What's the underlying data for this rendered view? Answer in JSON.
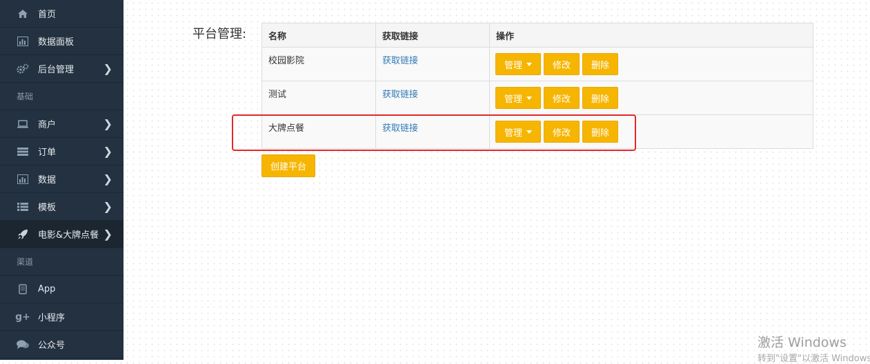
{
  "sidebar": {
    "items": [
      {
        "label": "首页",
        "icon": "home-icon"
      },
      {
        "label": "数据面板",
        "icon": "bar-chart-icon"
      },
      {
        "label": "后台管理",
        "icon": "gears-icon",
        "has_children": true
      }
    ],
    "section_basic": "基础",
    "basic_items": [
      {
        "label": "商户",
        "icon": "laptop-icon",
        "has_children": true
      },
      {
        "label": "订单",
        "icon": "list-box-icon",
        "has_children": true
      },
      {
        "label": "数据",
        "icon": "bar-chart-icon",
        "has_children": true
      },
      {
        "label": "模板",
        "icon": "list-icon",
        "has_children": true
      },
      {
        "label": "电影&大牌点餐",
        "icon": "rocket-icon",
        "has_children": true,
        "active": true
      }
    ],
    "section_channel": "渠道",
    "channel_items": [
      {
        "label": "App",
        "icon": "tablet-icon"
      },
      {
        "label": "小程序",
        "icon": "google-plus-icon"
      },
      {
        "label": "公众号",
        "icon": "chat-icon"
      }
    ]
  },
  "main": {
    "title": "平台管理:",
    "table": {
      "headers": [
        "名称",
        "获取链接",
        "操作"
      ],
      "rows": [
        {
          "name": "校园影院",
          "link": "获取链接"
        },
        {
          "name": "测试",
          "link": "获取链接"
        },
        {
          "name": "大牌点餐",
          "link": "获取链接"
        }
      ],
      "actions": {
        "manage": "管理",
        "edit": "修改",
        "delete": "删除"
      }
    },
    "create_button": "创建平台"
  },
  "watermark": {
    "title": "激活 Windows",
    "subtitle": "转到\"设置\"以激活 Windows。"
  },
  "colors": {
    "sidebar_bg": "#233140",
    "button": "#f6b500",
    "highlight": "#e42626",
    "link": "#337ab7"
  }
}
